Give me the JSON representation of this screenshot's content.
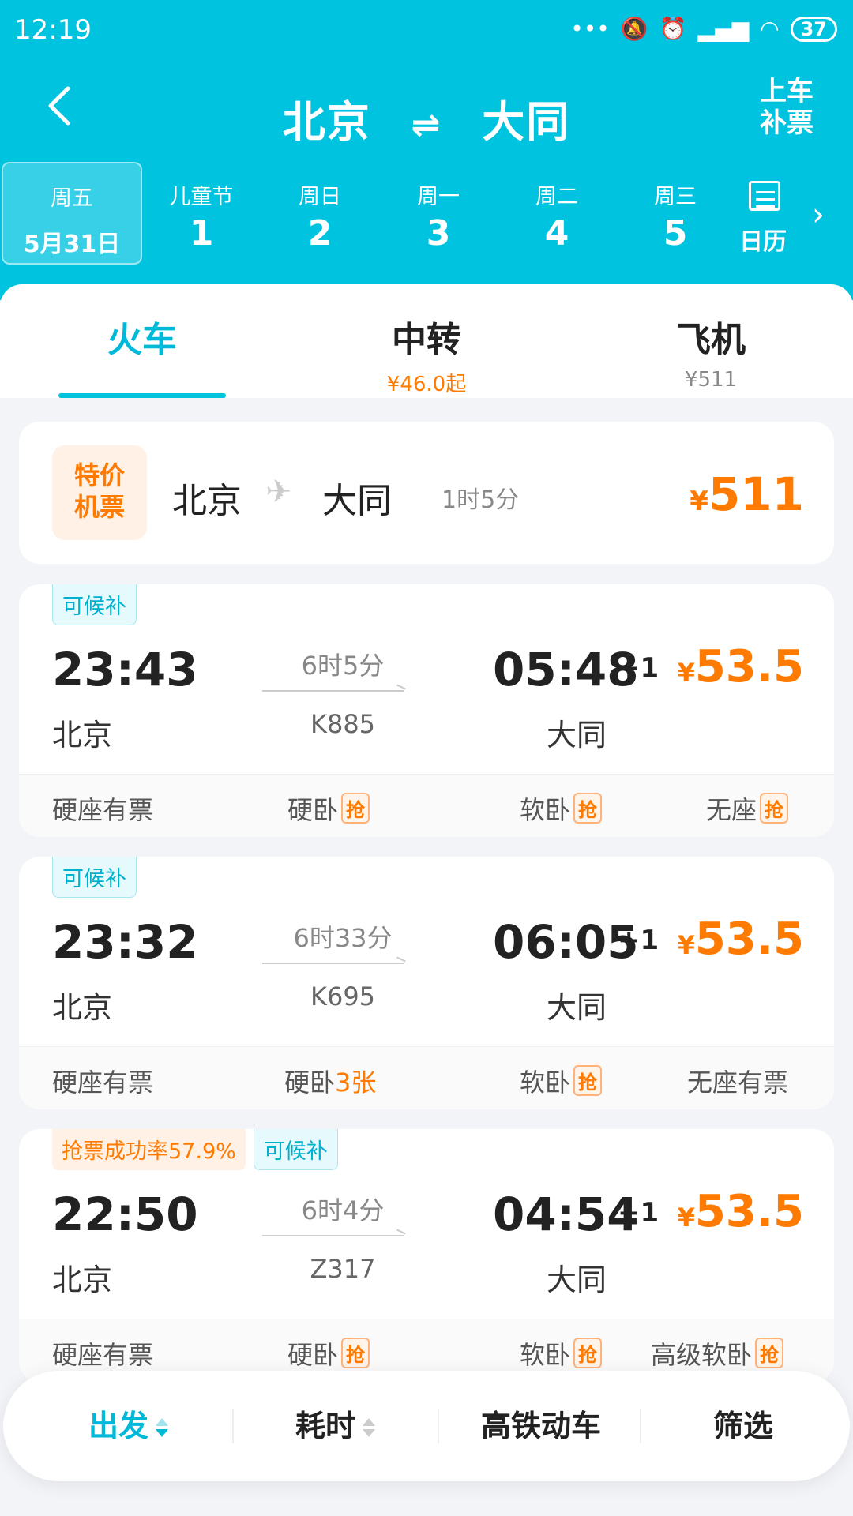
{
  "status": {
    "time": "12:19",
    "battery": "37"
  },
  "header": {
    "from": "北京",
    "to": "大同",
    "swap_icon": "⇌",
    "right_action_line1": "上车",
    "right_action_line2": "补票"
  },
  "dates": [
    {
      "weekday": "周五",
      "day": "5月31日",
      "selected": true
    },
    {
      "weekday": "儿童节",
      "day": "1"
    },
    {
      "weekday": "周日",
      "day": "2"
    },
    {
      "weekday": "周一",
      "day": "3"
    },
    {
      "weekday": "周二",
      "day": "4"
    },
    {
      "weekday": "周三",
      "day": "5"
    }
  ],
  "calendar_label": "日历",
  "tabs": [
    {
      "label": "火车",
      "sub": ""
    },
    {
      "label": "中转",
      "sub": "¥46.0起"
    },
    {
      "label": "飞机",
      "sub": "¥511"
    }
  ],
  "flight_promo": {
    "badge_line1": "特价",
    "badge_line2": "机票",
    "from": "北京",
    "to": "大同",
    "duration": "1时5分",
    "currency": "¥",
    "price": "511"
  },
  "trains": [
    {
      "tags": [
        "可候补"
      ],
      "dep_time": "23:43",
      "dep_station": "北京",
      "duration": "6时5分",
      "train_no": "K885",
      "arr_time": "05:48",
      "day_offset": "+1",
      "arr_station": "大同",
      "currency": "¥",
      "price": "53.5",
      "seats": [
        {
          "name": "硬座有票"
        },
        {
          "name": "硬卧",
          "grab": "抢"
        },
        {
          "name": "软卧",
          "grab": "抢"
        },
        {
          "name": "无座",
          "grab": "抢"
        }
      ]
    },
    {
      "tags": [
        "可候补"
      ],
      "dep_time": "23:32",
      "dep_station": "北京",
      "duration": "6时33分",
      "train_no": "K695",
      "arr_time": "06:05",
      "day_offset": "+1",
      "arr_station": "大同",
      "currency": "¥",
      "price": "53.5",
      "seats": [
        {
          "name": "硬座有票"
        },
        {
          "name": "硬卧",
          "count": "3张"
        },
        {
          "name": "软卧",
          "grab": "抢"
        },
        {
          "name": "无座有票"
        }
      ]
    },
    {
      "tags": [
        "抢票成功率57.9%",
        "可候补"
      ],
      "dep_time": "22:50",
      "dep_station": "北京",
      "duration": "6时4分",
      "train_no": "Z317",
      "arr_time": "04:54",
      "day_offset": "+1",
      "arr_station": "大同",
      "currency": "¥",
      "price": "53.5",
      "seats": [
        {
          "name": "硬座有票"
        },
        {
          "name": "硬卧",
          "grab": "抢"
        },
        {
          "name": "软卧",
          "grab": "抢"
        },
        {
          "name": "高级软卧",
          "grab": "抢"
        }
      ]
    }
  ],
  "sortbar": [
    {
      "label": "出发",
      "active": true
    },
    {
      "label": "耗时"
    },
    {
      "label": "高铁动车"
    },
    {
      "label": "筛选"
    }
  ],
  "colors": {
    "brand": "#00c3e0",
    "price": "#ff7a00"
  }
}
